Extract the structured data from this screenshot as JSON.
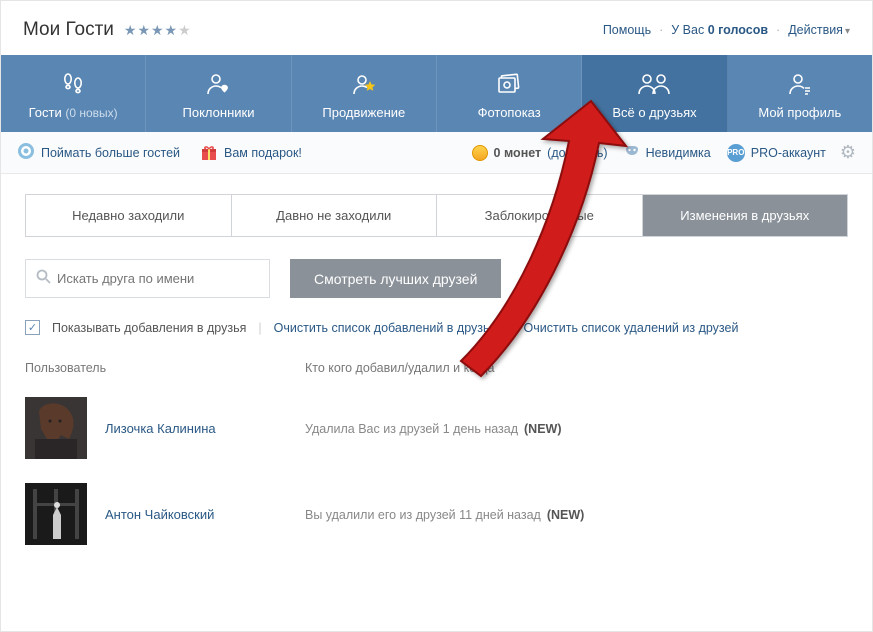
{
  "header": {
    "title": "Мои Гости",
    "help": "Помощь",
    "votes_prefix": "У Вас ",
    "votes_bold": "0 голосов",
    "actions": "Действия"
  },
  "nav": {
    "guests": "Гости",
    "guests_sub": "(0 новых)",
    "fans": "Поклонники",
    "promo": "Продвижение",
    "photo": "Фотопоказ",
    "friends": "Всё о друзьях",
    "profile": "Мой профиль"
  },
  "toolbar": {
    "catch_more": "Поймать больше гостей",
    "gift": "Вам подарок!",
    "coins_count": "0 монет",
    "buy": "(докупить)",
    "invisible": "Невидимка",
    "pro": "PRO-аккаунт"
  },
  "subtabs": {
    "recent": "Недавно заходили",
    "long": "Давно не заходили",
    "blocked": "Заблокированные",
    "changes": "Изменения в друзьях"
  },
  "controls": {
    "search_placeholder": "Искать друга по имени",
    "best_friends": "Смотреть лучших друзей"
  },
  "filter": {
    "show_additions": "Показывать добавления в друзья",
    "clear_additions": "Очистить список добавлений в друзья",
    "clear_removals": "Очистить список удалений из друзей"
  },
  "table": {
    "user_header": "Пользователь",
    "action_header": "Кто кого добавил/удалил и когда"
  },
  "rows": [
    {
      "name": "Лизочка Калинина",
      "action": "Удалила Вас из друзей 1 день назад",
      "new": "(NEW)"
    },
    {
      "name": "Антон Чайковский",
      "action": "Вы удалили его из друзей 11 дней назад",
      "new": "(NEW)"
    }
  ]
}
